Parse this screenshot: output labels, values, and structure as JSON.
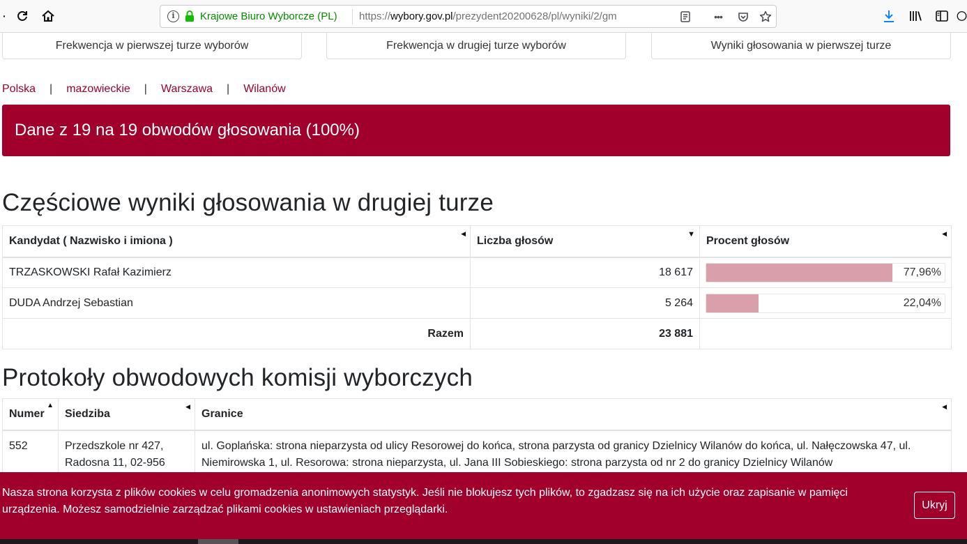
{
  "browser": {
    "identity": "Krajowe Biuro Wyborcze (PL)",
    "url_prefix": "https://",
    "url_host": "wybory.gov.pl",
    "url_path": "/prezydent20200628/pl/wyniki/2/gm"
  },
  "top_tabs": [
    {
      "label": "Frekwencja w pierwszej turze wyborów"
    },
    {
      "label": "Frekwencja w drugiej turze wyborów"
    },
    {
      "label": "Wyniki głosowania w pierwszej turze"
    }
  ],
  "breadcrumb": [
    "Polska",
    "mazowieckie",
    "Warszawa",
    "Wilanów"
  ],
  "banner": "Dane z 19 na 19 obwodów głosowania (100%)",
  "results": {
    "heading": "Częściowe wyniki głosowania w drugiej turze",
    "headers": [
      "Kandydat ( Nazwisko i imiona )",
      "Liczba głosów",
      "Procent głosów"
    ],
    "rows": [
      {
        "name": "TRZASKOWSKI Rafał Kazimierz",
        "votes": "18 617",
        "percent": "77,96%",
        "fraction": 0.7796
      },
      {
        "name": "DUDA Andrzej Sebastian",
        "votes": "5 264",
        "percent": "22,04%",
        "fraction": 0.2204
      }
    ],
    "total_label": "Razem",
    "total_votes": "23 881"
  },
  "protocols": {
    "heading": "Protokoły obwodowych komisji wyborczych",
    "headers": [
      "Numer",
      "Siedziba",
      "Granice"
    ],
    "rows": [
      {
        "number": "552",
        "seat": "Przedszkole nr 427, Radosna 11, 02-956",
        "bounds": "ul. Goplańska: strona nieparzysta od ulicy Resorowej do końca, strona parzysta od granicy Dzielnicy Wilanów do końca, ul. Nałęczowska 47, ul. Niemirowska 1, ul. Resorowa: strona nieparzysta, ul. Jana III Sobieskiego: strona parzysta od nr 2 do granicy Dzielnicy Wilanów"
      }
    ]
  },
  "cookie": {
    "text": "Nasza strona korzysta z plików cookies w celu gromadzenia anonimowych statystyk. Jeśli nie blokujesz tych plików, to zgadzasz się na ich użycie oraz zapisanie w pamięci urządzenia. Możesz samodzielnie zarządzać plikami cookies w ustawieniach przeglądarki.",
    "button": "Ukryj"
  },
  "colors": {
    "brand": "#a1002d",
    "bar_fill": "#d9a0ab",
    "identity_green": "#058b00"
  }
}
